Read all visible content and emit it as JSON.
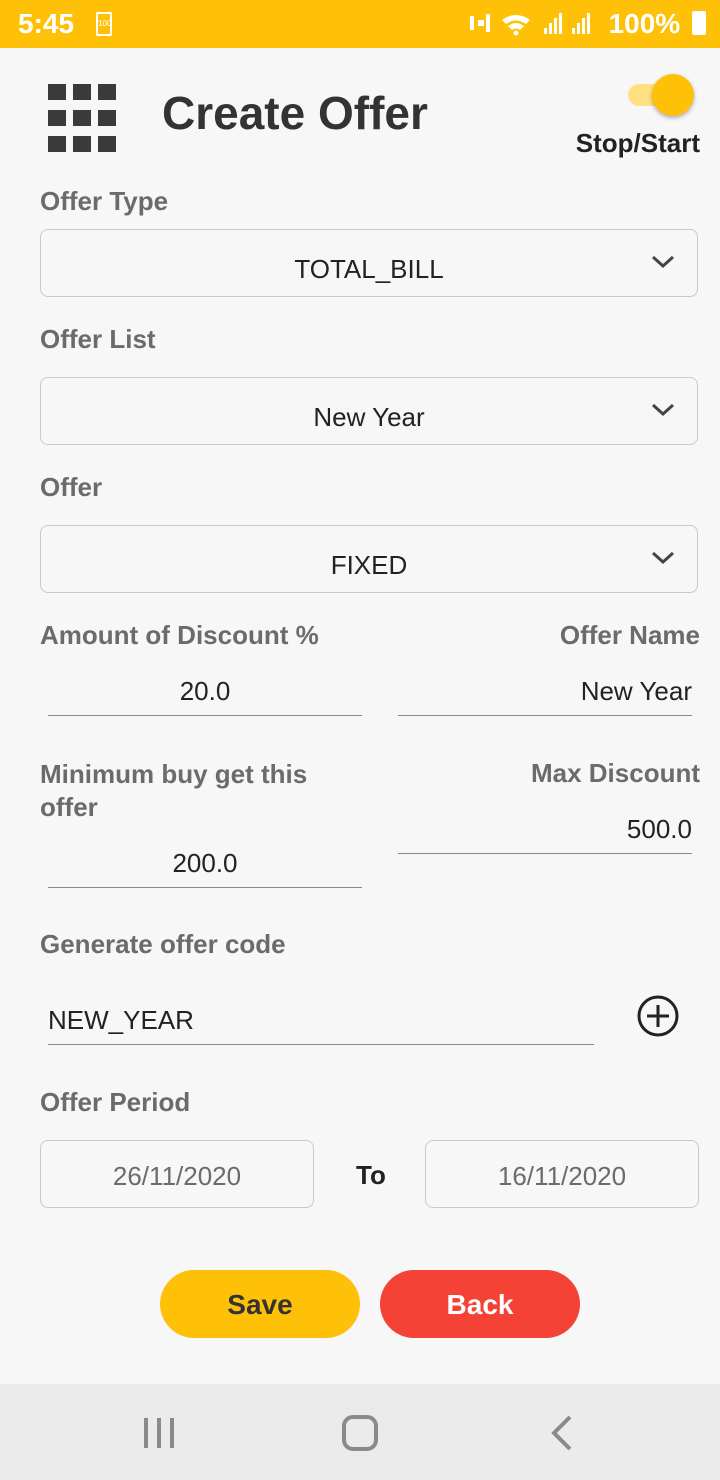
{
  "status_bar": {
    "time": "5:45",
    "battery_small": "100",
    "battery": "100%"
  },
  "header": {
    "title": "Create Offer",
    "toggle_label": "Stop/Start"
  },
  "form": {
    "offer_type": {
      "label": "Offer Type",
      "value": "TOTAL_BILL"
    },
    "offer_list": {
      "label": "Offer List",
      "value": "New Year"
    },
    "offer": {
      "label": "Offer",
      "value": "FIXED"
    },
    "amount_discount": {
      "label": "Amount of Discount %",
      "value": "20.0"
    },
    "offer_name": {
      "label": "Offer Name",
      "value": "New Year"
    },
    "min_buy": {
      "label_line1": "Minimum buy get this",
      "label_line2": "offer",
      "value": "200.0"
    },
    "max_discount": {
      "label": "Max Discount",
      "value": "500.0"
    },
    "offer_code": {
      "label": "Generate offer code",
      "value": "NEW_YEAR"
    },
    "offer_period": {
      "label": "Offer Period",
      "from": "26/11/2020",
      "to_label": "To",
      "to": "16/11/2020"
    }
  },
  "buttons": {
    "save": "Save",
    "back": "Back"
  },
  "colors": {
    "accent": "#FFC107",
    "danger": "#F44336"
  }
}
